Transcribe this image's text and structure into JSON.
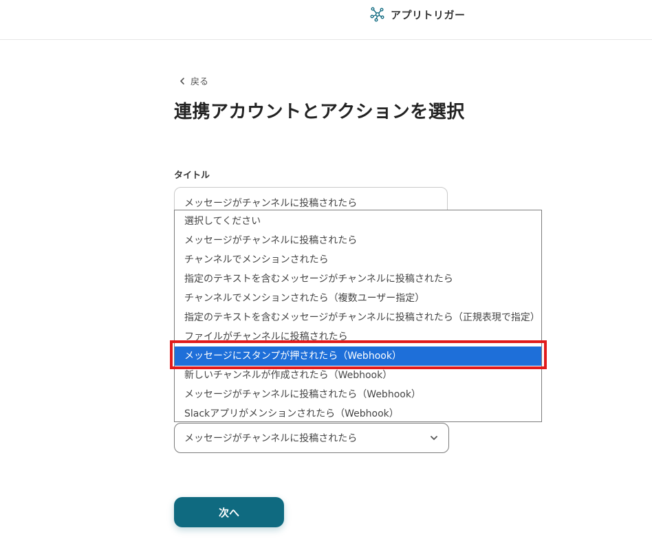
{
  "header": {
    "app_name": "アプリトリガー",
    "icon": "network-nodes-icon",
    "accent": "#0f6a80"
  },
  "back_link": {
    "label": "戻る",
    "icon": "chevron-left-icon"
  },
  "page_title": "連携アカウントとアクションを選択",
  "title_field": {
    "label": "タイトル",
    "value": "メッセージがチャンネルに投稿されたら"
  },
  "trigger_options": [
    "選択してください",
    "メッセージがチャンネルに投稿されたら",
    "チャンネルでメンションされたら",
    "指定のテキストを含むメッセージがチャンネルに投稿されたら",
    "チャンネルでメンションされたら（複数ユーザー指定）",
    "指定のテキストを含むメッセージがチャンネルに投稿されたら（正規表現で指定）",
    "ファイルがチャンネルに投稿されたら",
    "メッセージにスタンプが押されたら（Webhook）",
    "新しいチャンネルが作成されたら（Webhook）",
    "メッセージがチャンネルに投稿されたら（Webhook）",
    "Slackアプリがメンションされたら（Webhook）"
  ],
  "highlighted_option": "メッセージにスタンプが押されたら（Webhook）",
  "trigger_select": {
    "value": "メッセージがチャンネルに投稿されたら",
    "icon": "chevron-down-icon"
  },
  "next_button": {
    "label": "次へ"
  },
  "colors": {
    "selected_bg": "#1e6fd9",
    "highlight_border": "#e11b1b",
    "button_bg": "#0f6a80"
  }
}
